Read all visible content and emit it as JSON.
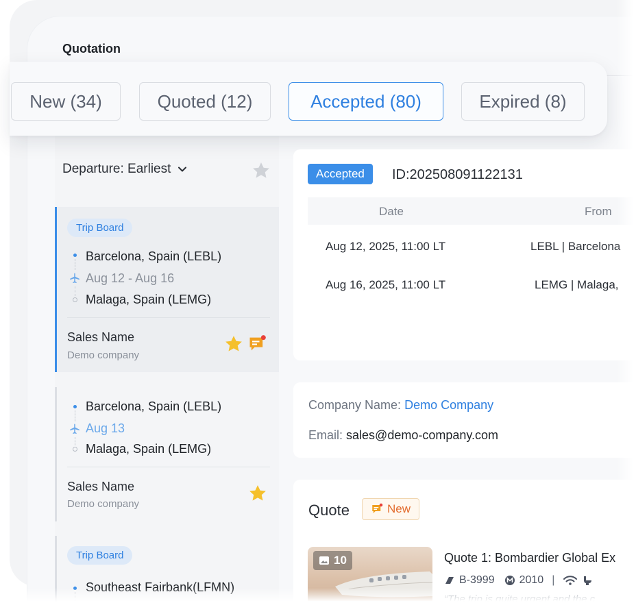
{
  "window": {
    "title": "Quotation"
  },
  "tabs": [
    {
      "label": "New (34)",
      "active": false
    },
    {
      "label": "Quoted (12)",
      "active": false
    },
    {
      "label": "Accepted (80)",
      "active": true
    },
    {
      "label": "Expired (8)",
      "active": false
    }
  ],
  "sort": {
    "label": "Departure: Earliest"
  },
  "trips": [
    {
      "badge": "Trip Board",
      "from": "Barcelona, Spain (LEBL)",
      "dates": "Aug 12 - Aug 16",
      "to": "Malaga, Spain (LEMG)",
      "sales_name": "Sales Name",
      "company": "Demo company",
      "starred": true,
      "has_message": true
    },
    {
      "badge": "",
      "from": "Barcelona, Spain (LEBL)",
      "dates": "Aug 13",
      "to": "Malaga, Spain (LEMG)",
      "sales_name": "Sales Name",
      "company": "Demo company",
      "starred": true,
      "has_message": false
    },
    {
      "badge": "Trip Board",
      "from": "Southeast Fairbank(LFMN)",
      "dates": "",
      "to": ""
    }
  ],
  "detail": {
    "status": "Accepted",
    "id": "ID:202508091122131",
    "table": {
      "headers": [
        "Date",
        "From"
      ],
      "rows": [
        [
          "Aug 12, 2025, 11:00 LT",
          "LEBL | Barcelona"
        ],
        [
          "Aug 16, 2025, 11:00 LT",
          "LEMG | Malaga,"
        ]
      ]
    },
    "company_label": "Company Name:",
    "company_value": "Demo Company",
    "email_label": "Email:",
    "email_value": "sales@demo-company.com"
  },
  "quote": {
    "heading": "Quote",
    "new_tag": "New",
    "photo_count": "10",
    "title": "Quote 1: Bombardier Global Ex",
    "tail": "B-3999",
    "year": "2010",
    "note": "“The trip is quite urgent and the c"
  },
  "colors": {
    "accent": "#3b8ee8",
    "star": "#f5c02c",
    "message": "#f0a020",
    "new_tag": "#e36b2c"
  }
}
